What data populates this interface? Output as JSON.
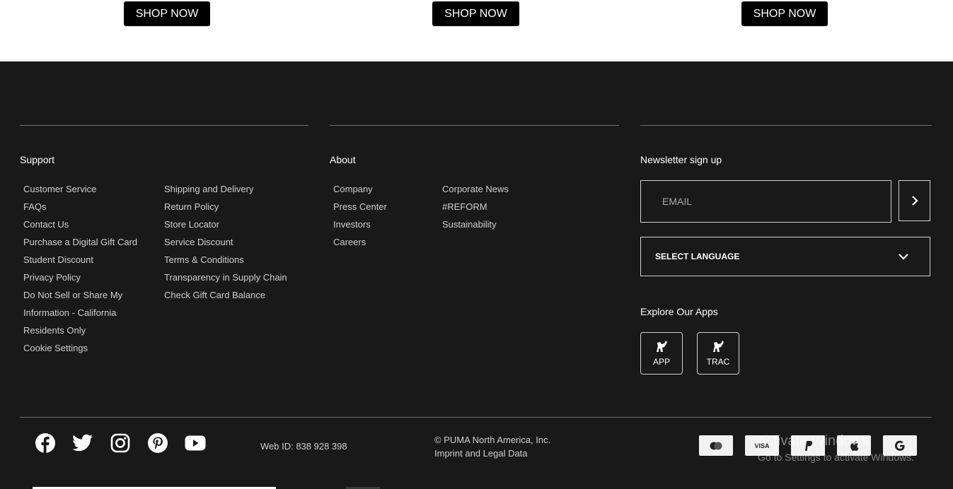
{
  "shop_buttons": [
    "SHOP NOW",
    "SHOP NOW",
    "SHOP NOW"
  ],
  "support": {
    "heading": "Support",
    "col1": [
      "Customer Service",
      "FAQs",
      "Contact Us",
      "Purchase a Digital Gift Card",
      "Student Discount",
      "Privacy Policy",
      "Do Not Sell or Share My",
      "Information - California",
      "Residents Only",
      "Cookie Settings"
    ],
    "col2": [
      "Shipping and Delivery",
      "Return Policy",
      "Store Locator",
      "Service Discount",
      "Terms & Conditions",
      "Transparency in Supply Chain",
      "Check Gift Card Balance"
    ]
  },
  "about": {
    "heading": "About",
    "col1": [
      "Company",
      "Press Center",
      "Investors",
      "Careers"
    ],
    "col2": [
      "Corporate News",
      "#REFORM",
      "Sustainability"
    ]
  },
  "newsletter": {
    "heading": "Newsletter sign up",
    "email_placeholder": "EMAIL",
    "language_label": "SELECT LANGUAGE"
  },
  "apps": {
    "heading": "Explore Our Apps",
    "items": [
      "APP",
      "TRAC"
    ]
  },
  "social_icons": [
    "facebook-icon",
    "twitter-icon",
    "instagram-icon",
    "pinterest-icon",
    "youtube-icon"
  ],
  "web_id": "Web ID: 838 928 398",
  "copyright": "© PUMA North America, Inc.",
  "imprint": "Imprint and Legal Data",
  "payments": [
    "mastercard-icon",
    "VISA",
    "paypal-icon",
    "apple-pay-icon",
    "google-pay-icon"
  ],
  "watermark": {
    "title": "Activate Windows",
    "subtitle": "Go to Settings to activate Windows."
  }
}
